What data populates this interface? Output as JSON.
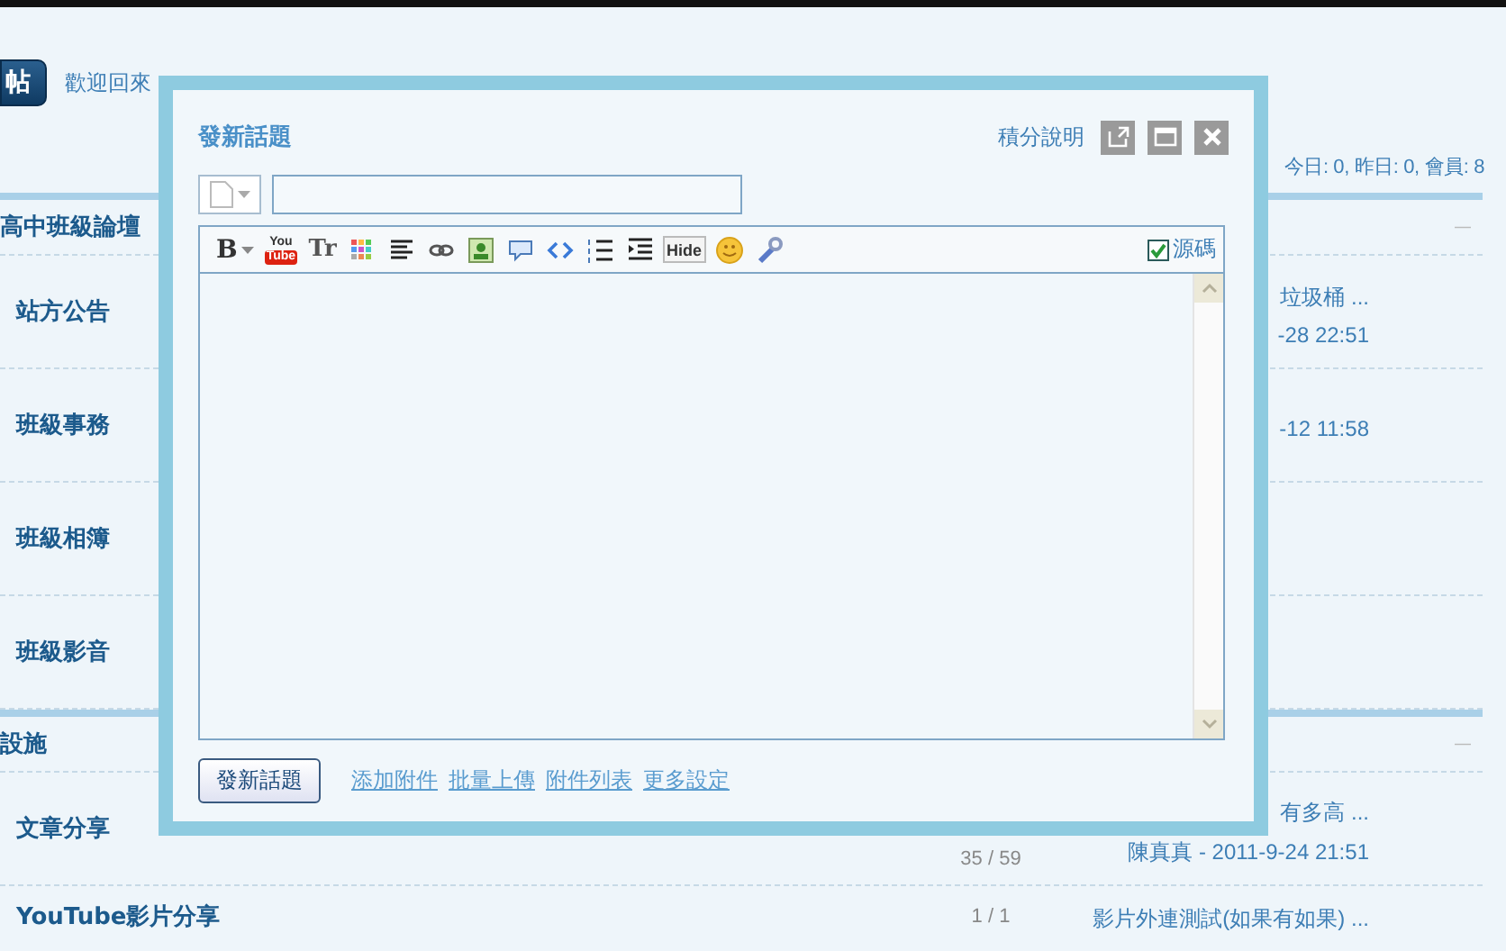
{
  "header": {
    "post_button": "帖",
    "welcome": "歡迎回來"
  },
  "stats": "今日: 0, 昨日: 0, 會員: 8",
  "sections": [
    {
      "title": "高中班級論壇",
      "collapse": "—",
      "forums": [
        {
          "name": "站方公告",
          "lastpost": [
            "垃圾桶 ...",
            "-28 22:51"
          ]
        },
        {
          "name": "班級事務",
          "lastpost": [
            "-12 11:58"
          ]
        },
        {
          "name": "班級相簿"
        },
        {
          "name": "班級影音"
        }
      ]
    },
    {
      "title": "設施",
      "collapse": "—",
      "forums": [
        {
          "name": "文章分享",
          "count": "35 / 59",
          "lastpost": [
            "有多高 ...",
            "陳真真 - 2011-9-24 21:51"
          ]
        },
        {
          "name": "YouTube影片分享",
          "count": "1 / 1",
          "lastpost": [
            "影片外連測試(如果有如果) ..."
          ]
        }
      ]
    }
  ],
  "dialog": {
    "title": "發新話題",
    "help_link": "積分說明",
    "window_buttons": [
      {
        "kind": "popout"
      },
      {
        "kind": "maximize"
      },
      {
        "kind": "close"
      }
    ],
    "toolbar": [
      {
        "kind": "bold",
        "label": "B"
      },
      {
        "kind": "youtube",
        "label": "You",
        "label2": "Tube"
      },
      {
        "kind": "size",
        "label": "Tr"
      },
      {
        "kind": "color"
      },
      {
        "kind": "align"
      },
      {
        "kind": "link"
      },
      {
        "kind": "image"
      },
      {
        "kind": "quote"
      },
      {
        "kind": "code"
      },
      {
        "kind": "olist"
      },
      {
        "kind": "indent"
      },
      {
        "kind": "hide",
        "label": "Hide"
      },
      {
        "kind": "smiley"
      },
      {
        "kind": "tools"
      }
    ],
    "source_mode": {
      "label": "源碼",
      "checked": true
    },
    "submit": "發新話題",
    "links": [
      "添加附件",
      "批量上傳",
      "附件列表",
      "更多設定"
    ]
  }
}
